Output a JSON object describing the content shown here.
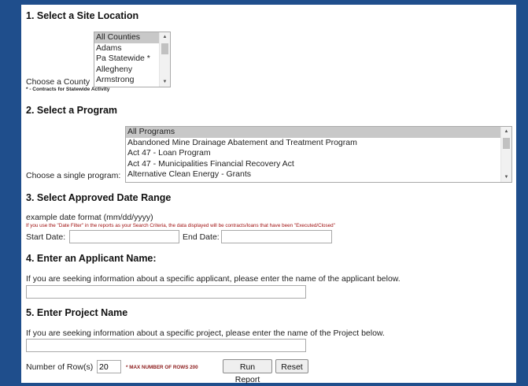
{
  "section1": {
    "title": "1. Select a Site Location",
    "label": "Choose a County",
    "note": "* - Contracts for Statewide Activity",
    "options": [
      "All Counties",
      "Adams",
      "Pa Statewide *",
      "Allegheny",
      "Armstrong"
    ],
    "selected": "All Counties"
  },
  "section2": {
    "title": "2. Select a Program",
    "label": "Choose a single program:",
    "options": [
      "All Programs",
      "Abandoned Mine Drainage Abatement and Treatment Program",
      "Act 47 - Loan Program",
      "Act 47 - Municipalities Financial Recovery Act",
      "Alternative Clean Energy - Grants"
    ],
    "selected": "All Programs"
  },
  "section3": {
    "title": "3. Select Approved Date Range",
    "example": "example date format (mm/dd/yyyy)",
    "warning": "If you use the \"Date Filter\" in the reports as your Search Criteria, the data displayed will be contracts/loans that have been \"Executed/Closed\"",
    "start_label": "Start Date:",
    "end_label": "End Date:",
    "start_value": "",
    "end_value": ""
  },
  "section4": {
    "title": "4. Enter an Applicant Name:",
    "help": "If you are seeking information about a specific applicant, please enter the name of the applicant below.",
    "value": ""
  },
  "section5": {
    "title": "5. Enter Project Name",
    "help": "If you are seeking information about a specific project, please enter the name of the Project below.",
    "value": ""
  },
  "footer": {
    "rows_label": "Number of Row(s)",
    "rows_value": "20",
    "max_note": "* MAX NUMBER OF ROWS 200",
    "run_label": "Run Report",
    "reset_label": "Reset"
  },
  "colors": {
    "background": "#1f4e8c",
    "selected_option": "#c8c8c8",
    "warning": "#a01010"
  }
}
